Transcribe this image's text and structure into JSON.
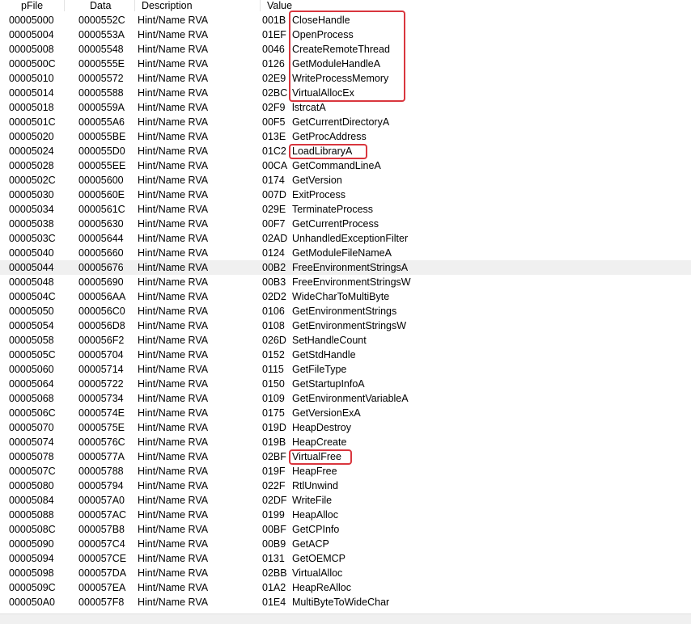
{
  "columns": [
    "pFile",
    "Data",
    "Description",
    "Value"
  ],
  "rows": [
    {
      "pfile": "00005000",
      "data": "0000552C",
      "desc": "Hint/Name RVA",
      "hint": "001B",
      "name": "CloseHandle"
    },
    {
      "pfile": "00005004",
      "data": "0000553A",
      "desc": "Hint/Name RVA",
      "hint": "01EF",
      "name": "OpenProcess"
    },
    {
      "pfile": "00005008",
      "data": "00005548",
      "desc": "Hint/Name RVA",
      "hint": "0046",
      "name": "CreateRemoteThread"
    },
    {
      "pfile": "0000500C",
      "data": "0000555E",
      "desc": "Hint/Name RVA",
      "hint": "0126",
      "name": "GetModuleHandleA"
    },
    {
      "pfile": "00005010",
      "data": "00005572",
      "desc": "Hint/Name RVA",
      "hint": "02E9",
      "name": "WriteProcessMemory"
    },
    {
      "pfile": "00005014",
      "data": "00005588",
      "desc": "Hint/Name RVA",
      "hint": "02BC",
      "name": "VirtualAllocEx"
    },
    {
      "pfile": "00005018",
      "data": "0000559A",
      "desc": "Hint/Name RVA",
      "hint": "02F9",
      "name": "lstrcatA"
    },
    {
      "pfile": "0000501C",
      "data": "000055A6",
      "desc": "Hint/Name RVA",
      "hint": "00F5",
      "name": "GetCurrentDirectoryA"
    },
    {
      "pfile": "00005020",
      "data": "000055BE",
      "desc": "Hint/Name RVA",
      "hint": "013E",
      "name": "GetProcAddress"
    },
    {
      "pfile": "00005024",
      "data": "000055D0",
      "desc": "Hint/Name RVA",
      "hint": "01C2",
      "name": "LoadLibraryA"
    },
    {
      "pfile": "00005028",
      "data": "000055EE",
      "desc": "Hint/Name RVA",
      "hint": "00CA",
      "name": "GetCommandLineA"
    },
    {
      "pfile": "0000502C",
      "data": "00005600",
      "desc": "Hint/Name RVA",
      "hint": "0174",
      "name": "GetVersion"
    },
    {
      "pfile": "00005030",
      "data": "0000560E",
      "desc": "Hint/Name RVA",
      "hint": "007D",
      "name": "ExitProcess"
    },
    {
      "pfile": "00005034",
      "data": "0000561C",
      "desc": "Hint/Name RVA",
      "hint": "029E",
      "name": "TerminateProcess"
    },
    {
      "pfile": "00005038",
      "data": "00005630",
      "desc": "Hint/Name RVA",
      "hint": "00F7",
      "name": "GetCurrentProcess"
    },
    {
      "pfile": "0000503C",
      "data": "00005644",
      "desc": "Hint/Name RVA",
      "hint": "02AD",
      "name": "UnhandledExceptionFilter"
    },
    {
      "pfile": "00005040",
      "data": "00005660",
      "desc": "Hint/Name RVA",
      "hint": "0124",
      "name": "GetModuleFileNameA"
    },
    {
      "pfile": "00005044",
      "data": "00005676",
      "desc": "Hint/Name RVA",
      "hint": "00B2",
      "name": "FreeEnvironmentStringsA"
    },
    {
      "pfile": "00005048",
      "data": "00005690",
      "desc": "Hint/Name RVA",
      "hint": "00B3",
      "name": "FreeEnvironmentStringsW"
    },
    {
      "pfile": "0000504C",
      "data": "000056AA",
      "desc": "Hint/Name RVA",
      "hint": "02D2",
      "name": "WideCharToMultiByte"
    },
    {
      "pfile": "00005050",
      "data": "000056C0",
      "desc": "Hint/Name RVA",
      "hint": "0106",
      "name": "GetEnvironmentStrings"
    },
    {
      "pfile": "00005054",
      "data": "000056D8",
      "desc": "Hint/Name RVA",
      "hint": "0108",
      "name": "GetEnvironmentStringsW"
    },
    {
      "pfile": "00005058",
      "data": "000056F2",
      "desc": "Hint/Name RVA",
      "hint": "026D",
      "name": "SetHandleCount"
    },
    {
      "pfile": "0000505C",
      "data": "00005704",
      "desc": "Hint/Name RVA",
      "hint": "0152",
      "name": "GetStdHandle"
    },
    {
      "pfile": "00005060",
      "data": "00005714",
      "desc": "Hint/Name RVA",
      "hint": "0115",
      "name": "GetFileType"
    },
    {
      "pfile": "00005064",
      "data": "00005722",
      "desc": "Hint/Name RVA",
      "hint": "0150",
      "name": "GetStartupInfoA"
    },
    {
      "pfile": "00005068",
      "data": "00005734",
      "desc": "Hint/Name RVA",
      "hint": "0109",
      "name": "GetEnvironmentVariableA"
    },
    {
      "pfile": "0000506C",
      "data": "0000574E",
      "desc": "Hint/Name RVA",
      "hint": "0175",
      "name": "GetVersionExA"
    },
    {
      "pfile": "00005070",
      "data": "0000575E",
      "desc": "Hint/Name RVA",
      "hint": "019D",
      "name": "HeapDestroy"
    },
    {
      "pfile": "00005074",
      "data": "0000576C",
      "desc": "Hint/Name RVA",
      "hint": "019B",
      "name": "HeapCreate"
    },
    {
      "pfile": "00005078",
      "data": "0000577A",
      "desc": "Hint/Name RVA",
      "hint": "02BF",
      "name": "VirtualFree"
    },
    {
      "pfile": "0000507C",
      "data": "00005788",
      "desc": "Hint/Name RVA",
      "hint": "019F",
      "name": "HeapFree"
    },
    {
      "pfile": "00005080",
      "data": "00005794",
      "desc": "Hint/Name RVA",
      "hint": "022F",
      "name": "RtlUnwind"
    },
    {
      "pfile": "00005084",
      "data": "000057A0",
      "desc": "Hint/Name RVA",
      "hint": "02DF",
      "name": "WriteFile"
    },
    {
      "pfile": "00005088",
      "data": "000057AC",
      "desc": "Hint/Name RVA",
      "hint": "0199",
      "name": "HeapAlloc"
    },
    {
      "pfile": "0000508C",
      "data": "000057B8",
      "desc": "Hint/Name RVA",
      "hint": "00BF",
      "name": "GetCPInfo"
    },
    {
      "pfile": "00005090",
      "data": "000057C4",
      "desc": "Hint/Name RVA",
      "hint": "00B9",
      "name": "GetACP"
    },
    {
      "pfile": "00005094",
      "data": "000057CE",
      "desc": "Hint/Name RVA",
      "hint": "0131",
      "name": "GetOEMCP"
    },
    {
      "pfile": "00005098",
      "data": "000057DA",
      "desc": "Hint/Name RVA",
      "hint": "02BB",
      "name": "VirtualAlloc"
    },
    {
      "pfile": "0000509C",
      "data": "000057EA",
      "desc": "Hint/Name RVA",
      "hint": "01A2",
      "name": "HeapReAlloc"
    },
    {
      "pfile": "000050A0",
      "data": "000057F8",
      "desc": "Hint/Name RVA",
      "hint": "01E4",
      "name": "MultiByteToWideChar"
    }
  ],
  "selected_row": 17,
  "highlight_color": "#d9363e"
}
